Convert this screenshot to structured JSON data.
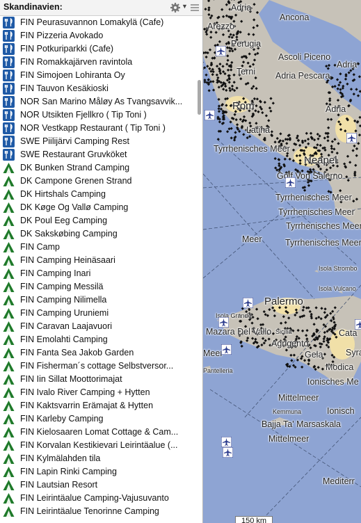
{
  "sidebar": {
    "title": "Skandinavien:",
    "items": [
      {
        "icon": "restaurant-icon",
        "label": "FIN Peurasuvannon Lomakylä (Cafe)"
      },
      {
        "icon": "restaurant-icon",
        "label": "FIN Pizzeria Avokado"
      },
      {
        "icon": "restaurant-icon",
        "label": "FIN Potkuriparkki (Cafe)"
      },
      {
        "icon": "restaurant-icon",
        "label": "FIN Romakkajärven ravintola"
      },
      {
        "icon": "restaurant-icon",
        "label": "FIN Simojoen Lohiranta Oy"
      },
      {
        "icon": "restaurant-icon",
        "label": "FIN Tauvon Kesäkioski"
      },
      {
        "icon": "restaurant-icon",
        "label": "NOR San Marino Måløy As Tvangsavvik..."
      },
      {
        "icon": "restaurant-icon",
        "label": "NOR Utsikten Fjellkro ( Tip Toni )"
      },
      {
        "icon": "restaurant-icon",
        "label": "NOR Vestkapp Restaurant ( Tip Toni )"
      },
      {
        "icon": "restaurant-icon",
        "label": "SWE Piilijärvi Camping Rest"
      },
      {
        "icon": "restaurant-icon",
        "label": "SWE Restaurant Gruvköket"
      },
      {
        "icon": "camping-icon",
        "label": "DK Bunken Strand Camping"
      },
      {
        "icon": "camping-icon",
        "label": "DK Campone Grenen Strand"
      },
      {
        "icon": "camping-icon",
        "label": "DK Hirtshals Camping"
      },
      {
        "icon": "camping-icon",
        "label": "DK Køge Og Vallø Camping"
      },
      {
        "icon": "camping-icon",
        "label": "DK Poul Eeg Camping"
      },
      {
        "icon": "camping-icon",
        "label": "DK Sakskøbing Camping"
      },
      {
        "icon": "camping-icon",
        "label": "FIN Camp"
      },
      {
        "icon": "camping-icon",
        "label": "FIN Camping Heinäsaari"
      },
      {
        "icon": "camping-icon",
        "label": "FIN Camping Inari"
      },
      {
        "icon": "camping-icon",
        "label": "FIN Camping Messilä"
      },
      {
        "icon": "camping-icon",
        "label": "FIN Camping Nilimella"
      },
      {
        "icon": "camping-icon",
        "label": "FIN Camping Uruniemi"
      },
      {
        "icon": "camping-icon",
        "label": "FIN Caravan Laajavuori"
      },
      {
        "icon": "camping-icon",
        "label": "FIN Emolahti Camping"
      },
      {
        "icon": "camping-icon",
        "label": "FIN Fanta Sea Jakob Garden"
      },
      {
        "icon": "camping-icon",
        "label": "FIN Fisherman´s cottage Selbstversor..."
      },
      {
        "icon": "camping-icon",
        "label": "FIN Iin Sillat Moottorimajat"
      },
      {
        "icon": "camping-icon",
        "label": "FIN Ivalo River Camping + Hytten"
      },
      {
        "icon": "camping-icon",
        "label": "FIN Kaktsvarrin Erämajat & Hytten"
      },
      {
        "icon": "camping-icon",
        "label": "FIN Karleby Camping"
      },
      {
        "icon": "camping-icon",
        "label": "FIN Kielosaaren Lomat Cottage & Cam..."
      },
      {
        "icon": "camping-icon",
        "label": "FIN Korvalan Kestikievari Leirintäalue (..."
      },
      {
        "icon": "camping-icon",
        "label": "FIN Kylmälahden tila"
      },
      {
        "icon": "camping-icon",
        "label": "FIN Lapin Rinki Camping"
      },
      {
        "icon": "camping-icon",
        "label": "FIN Lautsian Resort"
      },
      {
        "icon": "camping-icon",
        "label": "FIN Leirintäalue Camping-Vajusuvanto"
      },
      {
        "icon": "camping-icon",
        "label": "FIN Leirintäalue Tenorinne Camping"
      }
    ]
  },
  "map": {
    "labels": {
      "adria_top": "Adria",
      "ancona": "Ancona",
      "arezzo": "Arezzo",
      "perugia": "Perugia",
      "ascoli": "Ascoli Piceno",
      "terni": "Terni",
      "adria_pescara": "Adria Pescara",
      "adria_right": "Adria",
      "rom": "Rom",
      "adria_mid": "Adria",
      "latina": "Latina",
      "tyrr1": "Tyrrhenisches Meer",
      "neapel": "Neapel",
      "golf": "Golf Von Salerno",
      "tyrr2": "Tyrrhenisches Meer",
      "tyrr3": "Tyrrhenisches Meer",
      "tyrr4": "Tyrrhenisches Meer",
      "tyrr5": "Tyrrhenisches Meer",
      "meer_left": "Meer",
      "isola_stromboli": "Isola Strombo",
      "isola_vulcano": "Isola Vulcano",
      "palermo": "Palermo",
      "isola_grande": "Isola Grande",
      "mazara": "Mazara Del Vallo",
      "sicilia": "Sicilia",
      "cata": "Cata",
      "agrigento": "Agrigento",
      "meer_left2": "Meer",
      "gela": "Gela",
      "syra": "Syra",
      "modica": "Modica",
      "pantelleria": "Pantelleria",
      "ionisches": "Ionisches Me",
      "mittelmeer1": "Mittelmeer",
      "kemmuna": "Kemmuna",
      "ionisch2": "Ionisch",
      "bajja": "Bajja Ta' Marsaskala",
      "mittelmeer2": "Mittelmeer",
      "mittelmeer3": "Mediterr"
    },
    "scale_label": "150 km",
    "colors": {
      "sea": "#8ea4d3",
      "land": "#c7c2b8",
      "city": "#f1e0a8",
      "poi_dot": "#111111",
      "airport": "#2a3a8c"
    }
  }
}
